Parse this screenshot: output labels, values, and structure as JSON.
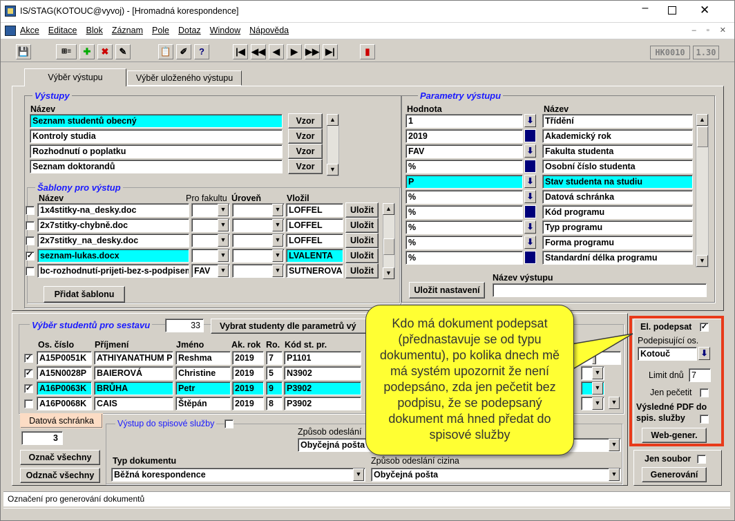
{
  "window": {
    "title": "IS/STAG(KOTOUC@vyvoj) - [Hromadná korespondence]"
  },
  "menu": [
    "Akce",
    "Editace",
    "Blok",
    "Záznam",
    "Pole",
    "Dotaz",
    "Window",
    "Nápověda"
  ],
  "toolbar": {
    "form_code": "HK0010",
    "version": "1.30"
  },
  "tabs": [
    "Výběr výstupu",
    "Výběr uloženého výstupu"
  ],
  "vystupy": {
    "title": "Výstupy",
    "col_name": "Název",
    "btn": "Vzor",
    "rows": [
      "Seznam studentů obecný",
      "Kontroly studia",
      "Rozhodnutí o poplatku",
      "Seznam doktorandů"
    ]
  },
  "sablony": {
    "title": "Šablony pro výstup",
    "col_name": "Název",
    "col_fac": "Pro fakultu",
    "col_level": "Úroveň",
    "col_by": "Vložil",
    "btn": "Uložit",
    "add_btn": "Přidat šablonu",
    "rows": [
      {
        "name": "1x4stitky-na_desky.doc",
        "fac": "",
        "by": "LOFFEL",
        "checked": false
      },
      {
        "name": "2x7stitky-chybně.doc",
        "fac": "",
        "by": "LOFFEL",
        "checked": false
      },
      {
        "name": "2x7stitky_na_desky.doc",
        "fac": "",
        "by": "LOFFEL",
        "checked": false
      },
      {
        "name": "seznam-lukas.docx",
        "fac": "",
        "by": "LVALENTA",
        "checked": true
      },
      {
        "name": "bc-rozhodnutí-prijeti-bez-s-podpisem",
        "fac": "FAV",
        "by": "SUTNEROVA",
        "checked": false
      }
    ]
  },
  "parametry": {
    "title": "Parametry výstupu",
    "col_value": "Hodnota",
    "col_name": "Název",
    "save_btn": "Uložit nastavení",
    "output_name_label": "Název výstupu",
    "rows": [
      {
        "value": "1",
        "name": "Třídění"
      },
      {
        "value": "2019",
        "name": "Akademický rok"
      },
      {
        "value": "FAV",
        "name": "Fakulta studenta"
      },
      {
        "value": "%",
        "name": "Osobní číslo studenta"
      },
      {
        "value": "P",
        "name": "Stav studenta na studiu"
      },
      {
        "value": "%",
        "name": "Datová schránka"
      },
      {
        "value": "%",
        "name": "Kód programu"
      },
      {
        "value": "%",
        "name": "Typ programu"
      },
      {
        "value": "%",
        "name": "Forma programu"
      },
      {
        "value": "%",
        "name": "Standardní délka programu"
      }
    ]
  },
  "studenti": {
    "title": "Výběr studentů pro sestavu",
    "count": "33",
    "select_btn": "Vybrat studenty dle parametrů vý",
    "cols": [
      "Os. číslo",
      "Příjmení",
      "Jméno",
      "Ak. rok",
      "Ro.",
      "Kód st. pr."
    ],
    "rows": [
      {
        "id": "A15P0051K",
        "surname": "ATHIYANATHUM P",
        "name": "Reshma",
        "year": "2019",
        "ro": "7",
        "code": "P1101",
        "checked": true
      },
      {
        "id": "A15N0028P",
        "surname": "BAIEROVÁ",
        "name": "Christine",
        "year": "2019",
        "ro": "5",
        "code": "N3902",
        "checked": true
      },
      {
        "id": "A16P0063K",
        "surname": "BRŮHA",
        "name": "Petr",
        "year": "2019",
        "ro": "9",
        "code": "P3902",
        "checked": true
      },
      {
        "id": "A16P0068K",
        "surname": "CAIS",
        "name": "Štěpán",
        "year": "2019",
        "ro": "8",
        "code": "P3902",
        "checked": false
      }
    ],
    "datova_btn": "Datová schránka",
    "datova_value": "3",
    "mark_all": "Označ všechny",
    "unmark_all": "Odznač všechny"
  },
  "spis": {
    "label": "Výstup do spisové služby",
    "zpusob_label": "Způsob odeslání",
    "zpusob_value": "Obyčejná pošta",
    "typ_label": "Typ dokumentu",
    "typ_value": "Běžná korespondence",
    "cizina_label": "Způsob odeslání cizina",
    "cizina_value": "Obyčejná pošta"
  },
  "podpis": {
    "el_label": "El. podepsat",
    "signer_label": "Podepisující os.",
    "signer_value": "Kotouč",
    "limit_label": "Limit dnů",
    "limit_value": "7",
    "seal_label": "Jen pečetit",
    "pdf_label": "Výsledné PDF do",
    "pdf_label2": "spis. služby",
    "web_btn": "Web-gener.",
    "only_file_label": "Jen soubor",
    "generate_btn": "Generování"
  },
  "callout": "Kdo má dokument podepsat (přednastavuje se od typu dokumentu), po kolika dnech mě má systém upozornit že není podepsáno, zda jen pečetit bez podpisu, že se podepsaný dokument má hned předat do spisové služby",
  "status": {
    "text": "Označení pro generování dokumentů"
  },
  "colors": {
    "highlight": "#00ffff",
    "callout": "#ffff33",
    "frame": "#e83a1a",
    "group_title": "#1a1aff"
  }
}
